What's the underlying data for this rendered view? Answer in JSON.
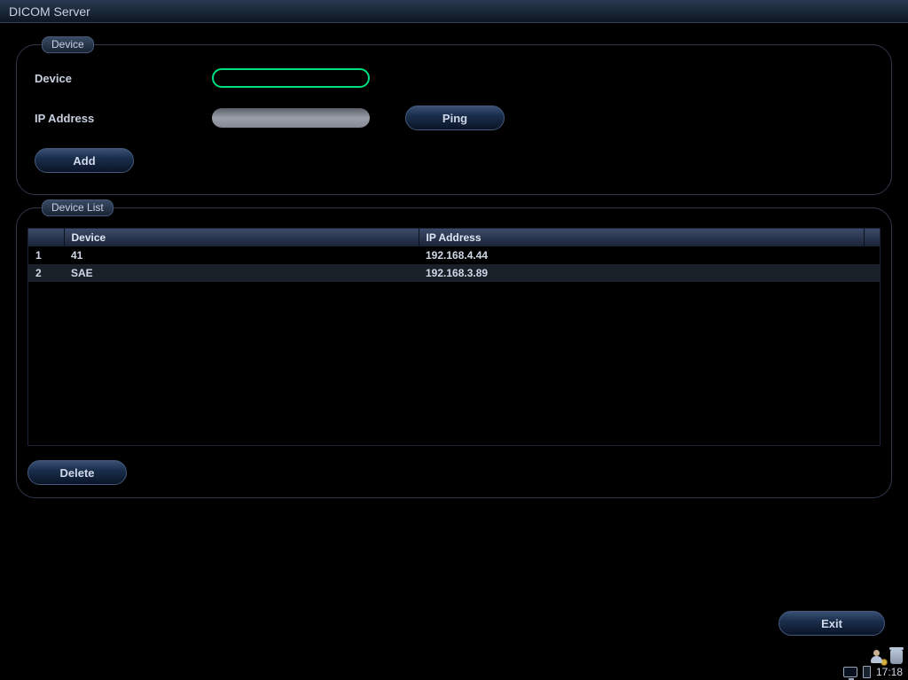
{
  "title": "DICOM Server",
  "device_group": {
    "legend": "Device",
    "device_label": "Device",
    "device_value": "",
    "ip_label": "IP Address",
    "ip_value": "",
    "ping_label": "Ping",
    "add_label": "Add"
  },
  "list_group": {
    "legend": "Device List",
    "columns": {
      "idx": "",
      "device": "Device",
      "ip": "IP Address"
    },
    "rows": [
      {
        "idx": "1",
        "device": "41",
        "ip": "192.168.4.44",
        "selected": false
      },
      {
        "idx": "2",
        "device": "SAE",
        "ip": "192.168.3.89",
        "selected": true
      }
    ],
    "delete_label": "Delete"
  },
  "footer": {
    "exit_label": "Exit",
    "time": "17:18"
  }
}
